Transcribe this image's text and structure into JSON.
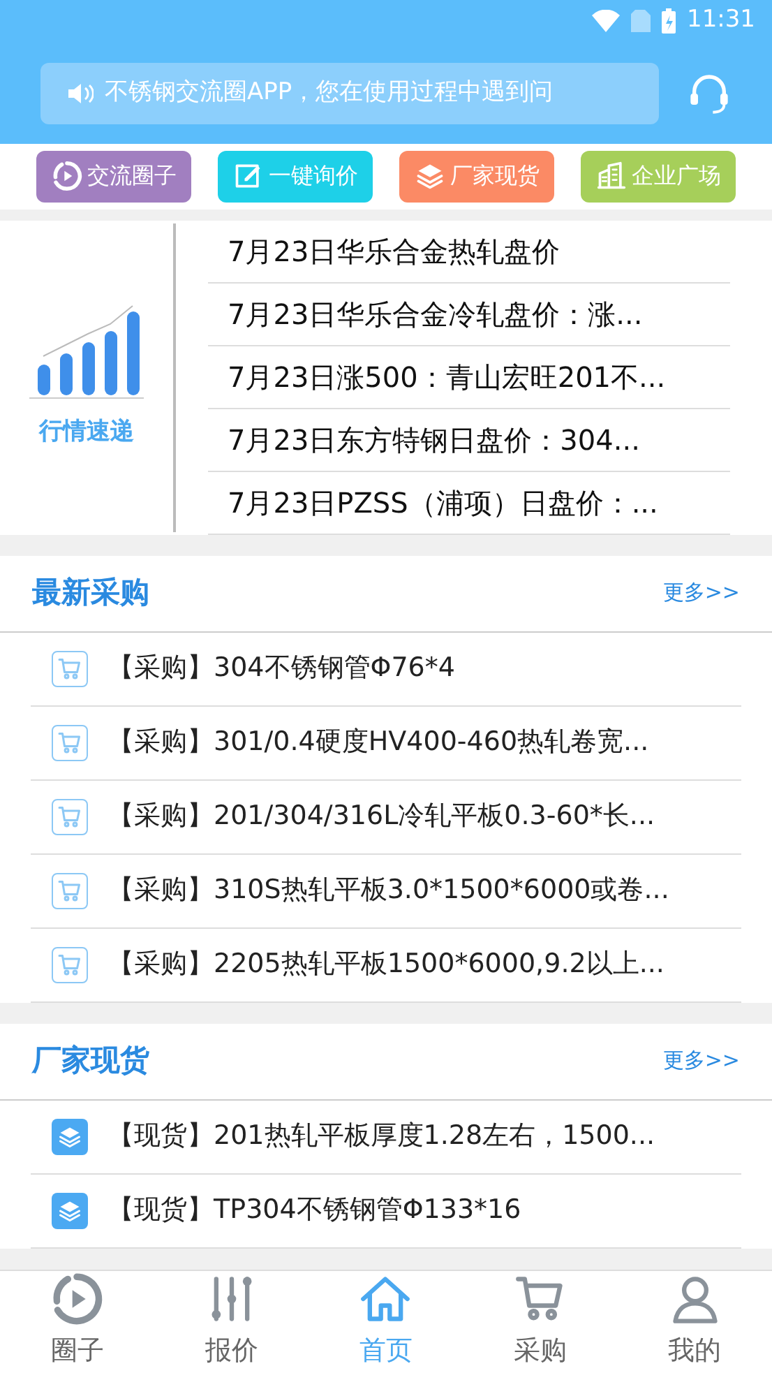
{
  "status_bar": {
    "time": "11:31"
  },
  "notice": {
    "text": "不锈钢交流圈APP，您在使用过程中遇到问"
  },
  "quick_links": [
    {
      "label": "交流圈子",
      "kind": "circle",
      "color": "#a17fc0"
    },
    {
      "label": "一键询价",
      "kind": "edit",
      "color": "#1ed0e8"
    },
    {
      "label": "厂家现货",
      "kind": "layers",
      "color": "#fb8a65"
    },
    {
      "label": "企业广场",
      "kind": "building",
      "color": "#a6cf5a"
    }
  ],
  "news": {
    "label": "行情速递",
    "items": [
      "7月23日华乐合金热轧盘价",
      "7月23日华乐合金冷轧盘价：涨...",
      "7月23日涨500：青山宏旺201不...",
      "7月23日东方特钢日盘价：304...",
      "7月23日PZSS（浦项）日盘价：..."
    ]
  },
  "sections": [
    {
      "title": "最新采购",
      "more": "更多>>",
      "kind": "cart",
      "items": [
        "【采购】304不锈钢管Φ76*4",
        "【采购】301/0.4硬度HV400-460热轧卷宽...",
        "【采购】201/304/316L冷轧平板0.3-60*长...",
        "【采购】310S热轧平板3.0*1500*6000或卷...",
        "【采购】2205热轧平板1500*6000,9.2以上..."
      ]
    },
    {
      "title": "厂家现货",
      "more": "更多>>",
      "kind": "layers",
      "items": [
        "【现货】201热轧平板厚度1.28左右，1500...",
        "【现货】TP304不锈钢管Φ133*16"
      ]
    }
  ],
  "tabs": [
    {
      "label": "圈子",
      "kind": "circle",
      "selected": false
    },
    {
      "label": "报价",
      "kind": "sliders",
      "selected": false
    },
    {
      "label": "首页",
      "kind": "home",
      "selected": true
    },
    {
      "label": "采购",
      "kind": "cart",
      "selected": false
    },
    {
      "label": "我的",
      "kind": "user",
      "selected": false
    }
  ]
}
